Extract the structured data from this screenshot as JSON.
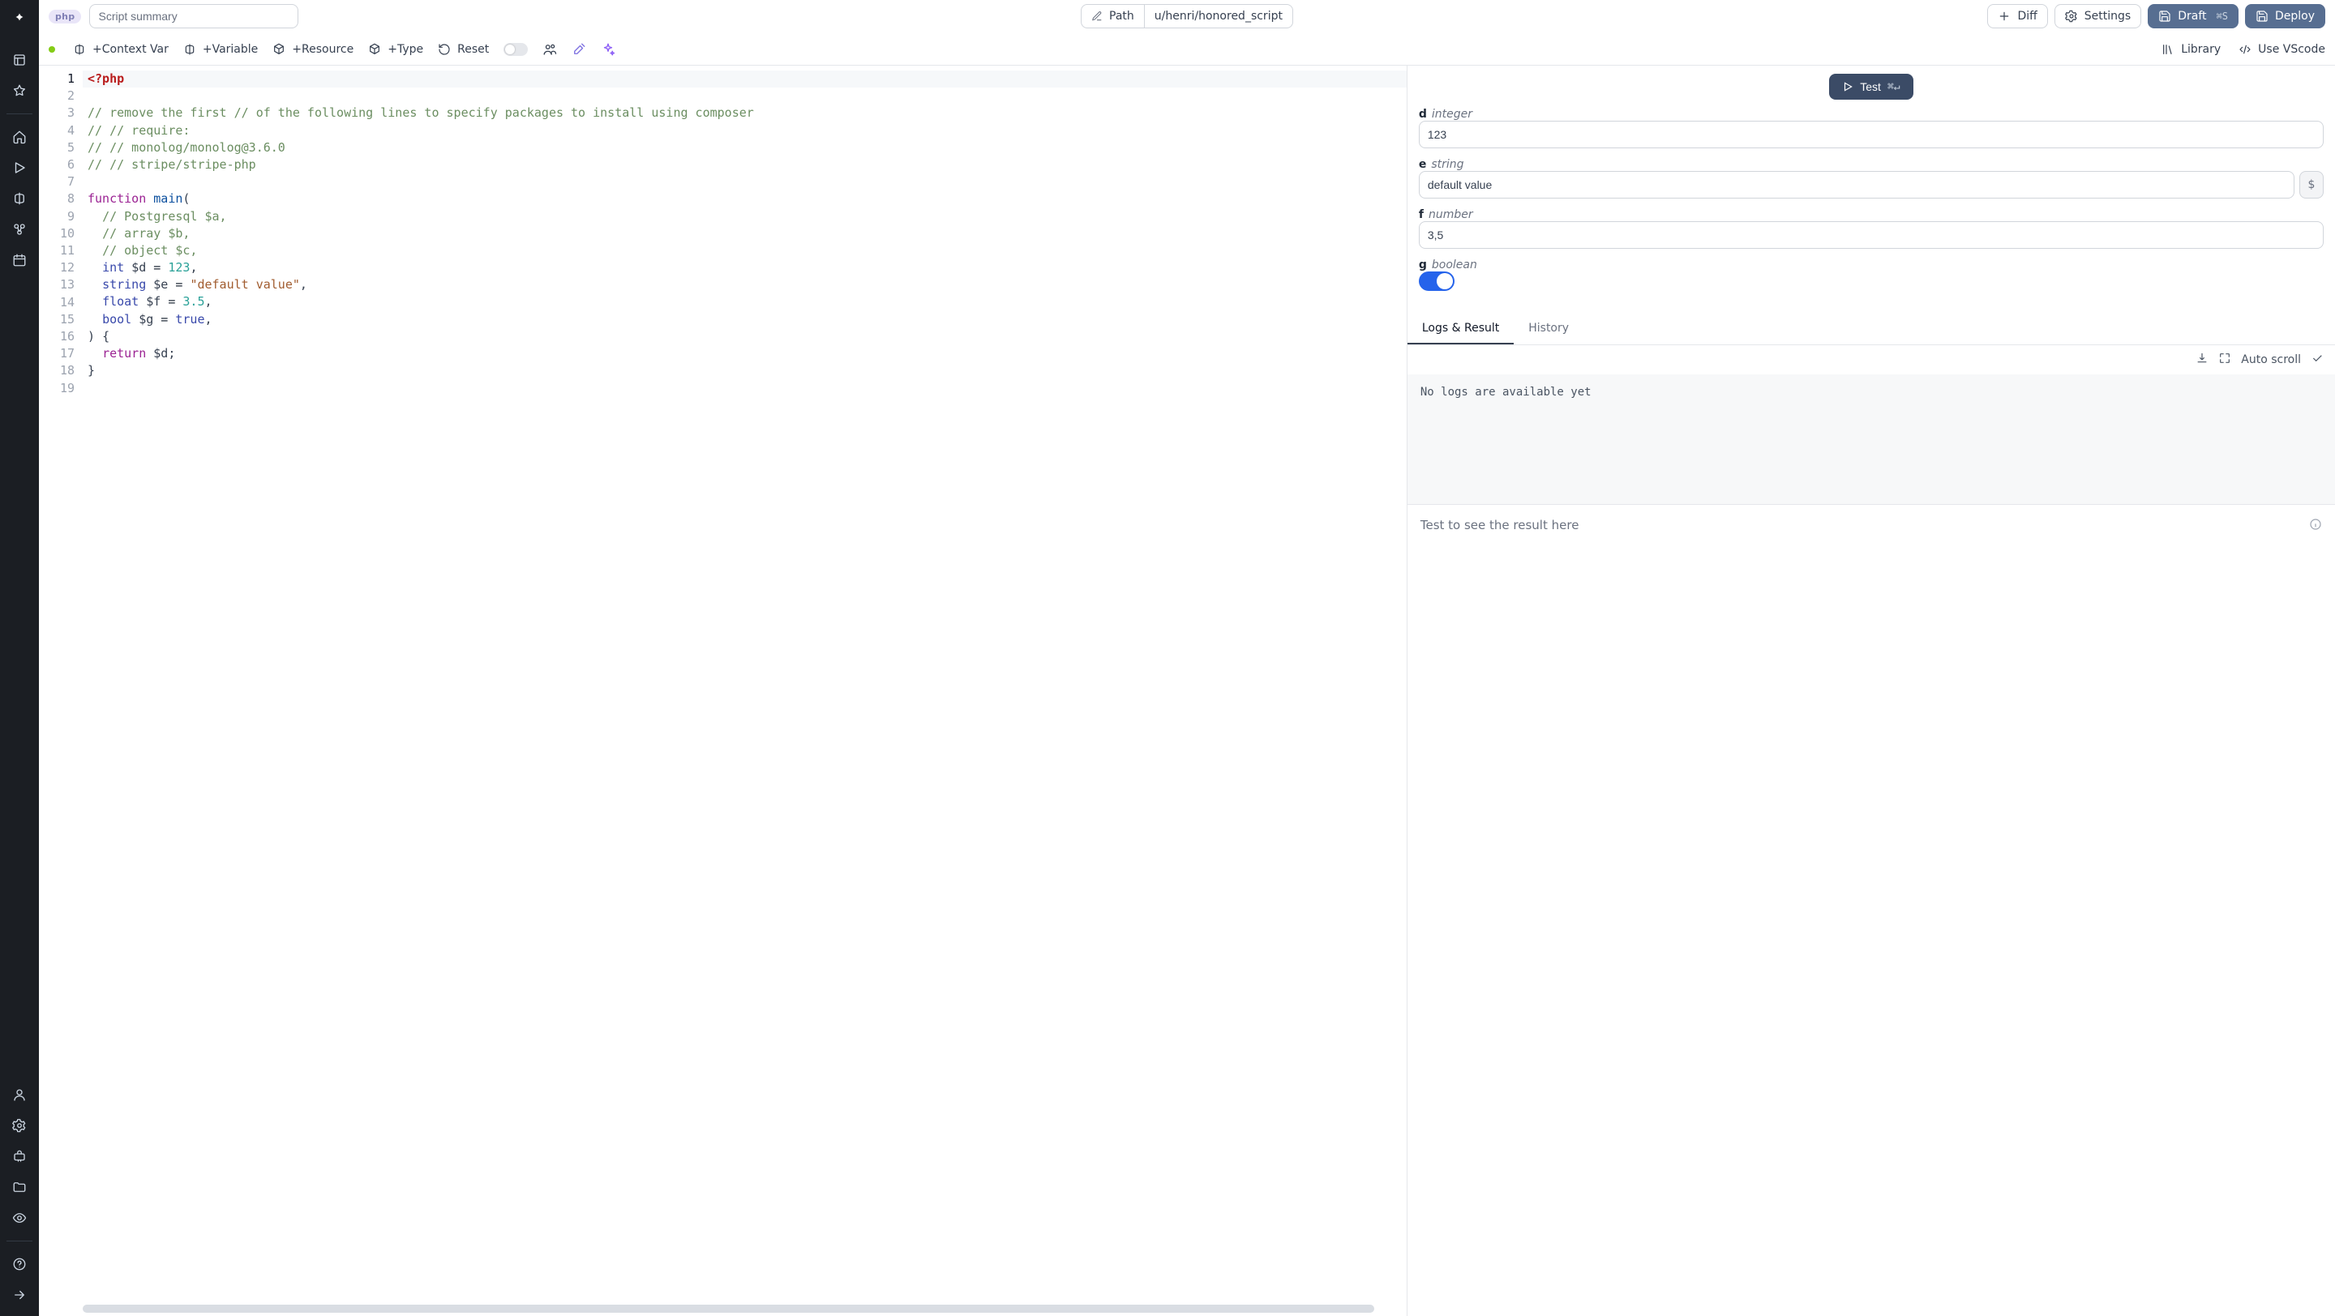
{
  "topbar": {
    "lang_badge": "php",
    "summary_placeholder": "Script summary",
    "path_label": "Path",
    "path_value": "u/henri/honored_script",
    "diff": "Diff",
    "settings": "Settings",
    "draft": "Draft",
    "draft_kbd": "⌘S",
    "deploy": "Deploy"
  },
  "toolbar": {
    "context_var": "+Context Var",
    "variable": "+Variable",
    "resource": "+Resource",
    "type": "+Type",
    "reset": "Reset",
    "library": "Library",
    "use_vscode": "Use VScode"
  },
  "editor": {
    "line_count": 19,
    "lines": [
      {
        "seg": [
          {
            "cls": "t-tag",
            "t": "<?php"
          }
        ]
      },
      {
        "seg": []
      },
      {
        "seg": [
          {
            "cls": "t-cmt",
            "t": "// remove the first // of the following lines to specify packages to install using composer"
          }
        ]
      },
      {
        "seg": [
          {
            "cls": "t-cmt",
            "t": "// // require:"
          }
        ]
      },
      {
        "seg": [
          {
            "cls": "t-cmt",
            "t": "// // monolog/monolog@3.6.0"
          }
        ]
      },
      {
        "seg": [
          {
            "cls": "t-cmt",
            "t": "// // stripe/stripe-php"
          }
        ]
      },
      {
        "seg": []
      },
      {
        "seg": [
          {
            "cls": "t-kw",
            "t": "function"
          },
          {
            "cls": "",
            "t": " "
          },
          {
            "cls": "t-id",
            "t": "main"
          },
          {
            "cls": "t-punc",
            "t": "("
          }
        ]
      },
      {
        "seg": [
          {
            "cls": "",
            "t": "  "
          },
          {
            "cls": "t-cmt",
            "t": "// Postgresql $a,"
          }
        ]
      },
      {
        "seg": [
          {
            "cls": "",
            "t": "  "
          },
          {
            "cls": "t-cmt",
            "t": "// array $b,"
          }
        ]
      },
      {
        "seg": [
          {
            "cls": "",
            "t": "  "
          },
          {
            "cls": "t-cmt",
            "t": "// object $c,"
          }
        ]
      },
      {
        "seg": [
          {
            "cls": "",
            "t": "  "
          },
          {
            "cls": "t-type",
            "t": "int"
          },
          {
            "cls": "",
            "t": " "
          },
          {
            "cls": "t-var",
            "t": "$d"
          },
          {
            "cls": "",
            "t": " = "
          },
          {
            "cls": "t-num",
            "t": "123"
          },
          {
            "cls": "t-punc",
            "t": ","
          }
        ]
      },
      {
        "seg": [
          {
            "cls": "",
            "t": "  "
          },
          {
            "cls": "t-type",
            "t": "string"
          },
          {
            "cls": "",
            "t": " "
          },
          {
            "cls": "t-var",
            "t": "$e"
          },
          {
            "cls": "",
            "t": " = "
          },
          {
            "cls": "t-str",
            "t": "\"default value\""
          },
          {
            "cls": "t-punc",
            "t": ","
          }
        ]
      },
      {
        "seg": [
          {
            "cls": "",
            "t": "  "
          },
          {
            "cls": "t-type",
            "t": "float"
          },
          {
            "cls": "",
            "t": " "
          },
          {
            "cls": "t-var",
            "t": "$f"
          },
          {
            "cls": "",
            "t": " = "
          },
          {
            "cls": "t-num",
            "t": "3.5"
          },
          {
            "cls": "t-punc",
            "t": ","
          }
        ]
      },
      {
        "seg": [
          {
            "cls": "",
            "t": "  "
          },
          {
            "cls": "t-type",
            "t": "bool"
          },
          {
            "cls": "",
            "t": " "
          },
          {
            "cls": "t-var",
            "t": "$g"
          },
          {
            "cls": "",
            "t": " = "
          },
          {
            "cls": "t-bool",
            "t": "true"
          },
          {
            "cls": "t-punc",
            "t": ","
          }
        ]
      },
      {
        "seg": [
          {
            "cls": "t-punc",
            "t": ")"
          },
          {
            "cls": "",
            "t": " "
          },
          {
            "cls": "t-punc",
            "t": "{"
          }
        ]
      },
      {
        "seg": [
          {
            "cls": "",
            "t": "  "
          },
          {
            "cls": "t-kw",
            "t": "return"
          },
          {
            "cls": "",
            "t": " "
          },
          {
            "cls": "t-var",
            "t": "$d"
          },
          {
            "cls": "t-punc",
            "t": ";"
          }
        ]
      },
      {
        "seg": [
          {
            "cls": "t-punc",
            "t": "}"
          }
        ]
      },
      {
        "seg": []
      }
    ]
  },
  "right": {
    "test": "Test",
    "test_kbd": "⌘↵",
    "inputs": [
      {
        "name": "d",
        "type": "integer",
        "value": "123",
        "addon": false
      },
      {
        "name": "e",
        "type": "string",
        "value": "default value",
        "addon": true
      },
      {
        "name": "f",
        "type": "number",
        "value": "3,5",
        "addon": false
      },
      {
        "name": "g",
        "type": "boolean",
        "value": "true",
        "addon": false
      }
    ],
    "tabs": {
      "logs": "Logs & Result",
      "history": "History"
    },
    "autoscroll": "Auto scroll",
    "no_logs": "No logs are available yet",
    "result_placeholder": "Test to see the result here"
  }
}
